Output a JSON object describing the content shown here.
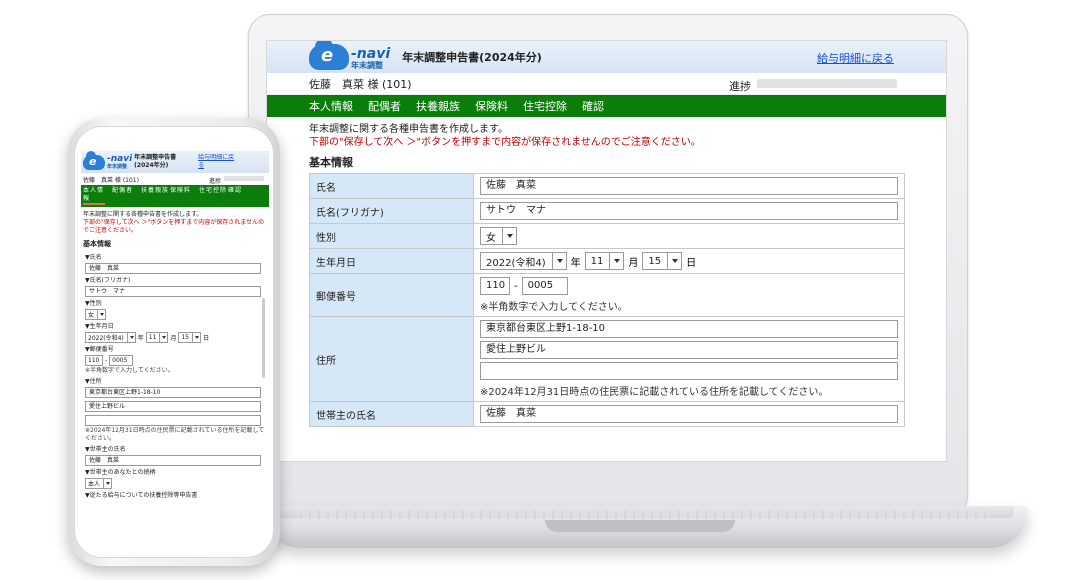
{
  "app": {
    "logo_mark": "e",
    "logo_name": "-navi",
    "logo_sub": "年末調整",
    "title": "年末調整申告書(2024年分)",
    "back_link": "給与明細に戻る",
    "user": "佐藤　真菜 様 (101)",
    "progress_label": "進捗",
    "progress_value": 0.0
  },
  "nav": [
    "本人情報",
    "配偶者",
    "扶養親族",
    "保険料",
    "住宅控除",
    "確認"
  ],
  "nav_mobile": [
    "本人情報",
    "配偶者",
    "扶養親族",
    "保険料",
    "住宅控除",
    "確認"
  ],
  "intro": {
    "line1": "年末調整に関する各種申告書を作成します。",
    "warning": "下部の\"保存して次へ ＞\"ボタンを押すまで内容が保存されませんのでご注意ください。"
  },
  "section_title": "基本情報",
  "form": {
    "name_label": "氏名",
    "name_value": "佐藤　真菜",
    "kana_label": "氏名(フリガナ)",
    "kana_value": "サトウ　マナ",
    "gender_label": "性別",
    "gender_value": "女",
    "birth_label": "生年月日",
    "birth_year": "2022(令和4)",
    "birth_year_unit": "年",
    "birth_month": "11",
    "birth_month_unit": "月",
    "birth_day": "15",
    "birth_day_unit": "日",
    "zip_label": "郵便番号",
    "zip1": "110",
    "zip_sep": "-",
    "zip2": "0005",
    "zip_note": "※半角数字で入力してください。",
    "address_label": "住所",
    "address1": "東京都台東区上野1-18-10",
    "address2": "愛住上野ビル",
    "address3": "",
    "address_note": "※2024年12月31日時点の住民票に記載されている住所を記載してください。",
    "head_label": "世帯主の氏名",
    "head_value": "佐藤　真菜",
    "relation_label": "世帯主のあなたとの続柄",
    "relation_value": "本人",
    "dependent_label": "従たる給与についての扶養控除等申告書"
  },
  "mobile_labels": {
    "name": "▼氏名",
    "kana": "▼氏名(フリガナ)",
    "gender": "▼性別",
    "birth": "▼生年月日",
    "zip": "▼郵便番号",
    "address": "▼住所",
    "head": "▼世帯主の氏名",
    "relation": "▼世帯主のあなたとの続柄",
    "dependent": "▼従たる給与についての扶養控除等申告書"
  }
}
